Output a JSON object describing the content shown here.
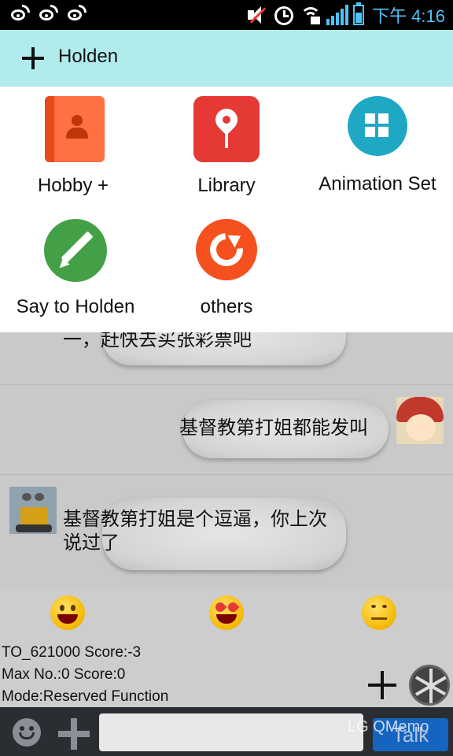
{
  "status_bar": {
    "notifications": [
      "weibo-icon",
      "weibo-icon",
      "weibo-icon"
    ],
    "icons": [
      "mute-icon",
      "alarm-icon",
      "wifi-locked-icon",
      "signal-icon",
      "battery-icon"
    ],
    "time": "下午 4:16"
  },
  "action_bar": {
    "title": "Holden",
    "add_icon": "plus-icon"
  },
  "menu": {
    "items": [
      {
        "label": "Hobby +",
        "icon": "contact-book-icon",
        "color": "#ff7043"
      },
      {
        "label": "Library",
        "icon": "map-pin-icon",
        "color": "#e53935"
      },
      {
        "label": "Animation Set",
        "icon": "grid-icon",
        "color": "#1fa8c3"
      },
      {
        "label": "Say to Holden",
        "icon": "pencil-icon",
        "color": "#43a047"
      },
      {
        "label": "others",
        "icon": "refresh-icon",
        "color": "#f4511e"
      }
    ]
  },
  "chat": {
    "messages": [
      {
        "side": "left",
        "text": "一，赶快去买张彩票吧"
      },
      {
        "side": "right",
        "text": "基督教第打姐都能发叫",
        "avatar": "boy-avatar"
      },
      {
        "side": "left",
        "text": "基督教第打姐是个逗逼，你上次说过了",
        "line1": "基督教第打姐是个逗逼，你上次",
        "line2": "说过了",
        "avatar": "robot-avatar"
      }
    ]
  },
  "emojis": [
    "laughing-emoji",
    "heart-eyes-emoji",
    "smirk-emoji"
  ],
  "info": {
    "line1": "TO_621000  Score:-3",
    "line2": "Max No.:0  Score:0",
    "line3": "Mode:Reserved Function"
  },
  "input_bar": {
    "talk_label": "Talk",
    "text_value": ""
  },
  "watermark": "LG QMemo",
  "colors": {
    "action_bar": "#b2ebec",
    "status_accent": "#4fc3f7",
    "talk_button": "#1565c0"
  }
}
